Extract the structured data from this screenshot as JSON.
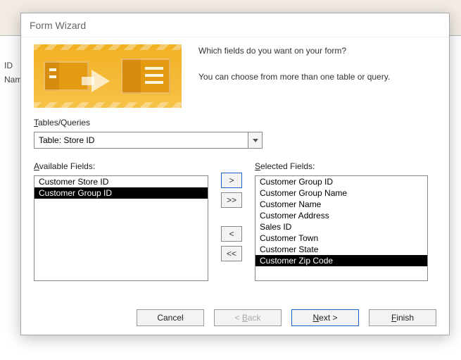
{
  "background": {
    "label_id": "ID",
    "label_name": "Nam"
  },
  "dialog": {
    "title": "Form Wizard",
    "hero_line1": "Which fields do you want on your form?",
    "hero_line2": "You can choose from more than one table or query.",
    "tables_label": "Tables/Queries",
    "tables_label_underline": "T",
    "combo_value": "Table: Store ID",
    "available_label": "Available Fields:",
    "available_label_underline": "A",
    "selected_label": "Selected Fields:",
    "selected_label_underline": "S",
    "available_items": [
      "Customer Store ID",
      "Customer Group ID"
    ],
    "available_selected_index": 1,
    "selected_items": [
      "Customer Group ID",
      "Customer Group Name",
      "Customer Name",
      "Customer Address",
      "Sales ID",
      "Customer Town",
      "Customer State",
      "Customer Zip Code"
    ],
    "selected_selected_index": 7,
    "move_buttons": {
      "add": ">",
      "add_all": ">>",
      "remove": "<",
      "remove_all": "<<"
    },
    "footer": {
      "cancel": "Cancel",
      "back": "< Back",
      "back_underline": "B",
      "next": "Next >",
      "next_underline": "N",
      "finish": "Finish",
      "finish_underline": "F"
    }
  }
}
